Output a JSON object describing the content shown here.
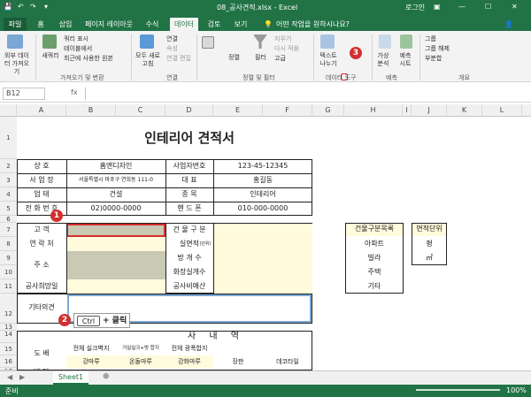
{
  "title_bar": {
    "filename": "08_공사견적.xlsx - Excel",
    "user": "로그인"
  },
  "tabs": [
    "파일",
    "홈",
    "삽입",
    "페이지 레이아웃",
    "수식",
    "데이터",
    "검토",
    "보기"
  ],
  "active_tab": "데이터",
  "tell_me": "어떤 작업을 원하시나요?",
  "ribbon": {
    "ext_data": "외부 데이터 가져오기",
    "new_query": "새쿼리",
    "show_query": "쿼리 표시",
    "from_table": "테이블에서",
    "recent": "최근에 사용한 원본",
    "refresh_all": "모두 새로 고침",
    "connections": "연결",
    "properties": "속성",
    "edit_links": "연결 편집",
    "sort": "정렬",
    "filter": "필터",
    "clear": "지우기",
    "reapply": "다시 적용",
    "advanced": "고급",
    "text_to_col": "텍스트 나누기",
    "whatif": "가상 분석",
    "forecast": "예측 시트",
    "group": "그룹",
    "ungroup": "그룹 해제",
    "subtotal": "부분합",
    "grp_get": "가져오기 및 변환",
    "grp_conn": "연결",
    "grp_sort": "정렬 및 필터",
    "grp_tools": "데이터 도구",
    "grp_forecast": "예측",
    "grp_outline": "개요"
  },
  "namebox": "B12",
  "fx": "fx",
  "columns": [
    "A",
    "B",
    "C",
    "D",
    "E",
    "F",
    "G",
    "H",
    "I",
    "J",
    "K",
    "L"
  ],
  "rows": [
    "1",
    "2",
    "3",
    "4",
    "5",
    "6",
    "7",
    "8",
    "9",
    "10",
    "11",
    "12",
    "13",
    "14",
    "15",
    "16",
    "17"
  ],
  "sheet": {
    "title": "인테리어 견적서",
    "r2": [
      "상 호",
      "홈앤디자인",
      "사업자번호",
      "123-45-12345"
    ],
    "r3": [
      "사 업 장",
      "서울특별시 마포구 연희동 111-0",
      "대 표",
      "홍길동"
    ],
    "r4": [
      "업 태",
      "건설",
      "종 목",
      "인테리어"
    ],
    "r5": [
      "전 화 번 호",
      "02)0000-0000",
      "핸 드 폰",
      "010-000-0000"
    ],
    "r7": [
      "고 객",
      "건 물 구 분"
    ],
    "r8": [
      "연 락 처",
      "실면적",
      "(단위)"
    ],
    "r9": [
      "주 소",
      "방 개 수"
    ],
    "r10": [
      "화장실개수"
    ],
    "r11": [
      "공사희망일",
      "공사비예산"
    ],
    "r12": [
      "기타의견"
    ],
    "r14": "사 내 역",
    "r15": [
      "도 배",
      "전체 실크벽지",
      "거실실크+방 합지",
      "전체 광폭합지"
    ],
    "r17": [
      "바 닥",
      "강마루",
      "온돌마루",
      "강화마루",
      "장판",
      "데코타일"
    ],
    "building_hdr": "건물구분목록",
    "building": [
      "아파트",
      "빌라",
      "주택",
      "기타"
    ],
    "area_hdr": "면적단위",
    "area": [
      "평",
      "㎡"
    ]
  },
  "callouts": {
    "b1": "1",
    "b2": "2",
    "b3": "3",
    "key": "Ctrl",
    "plus": "+ 클릭"
  },
  "sheet_tab": "Sheet1",
  "status": {
    "ready": "준비",
    "zoom": "100%"
  }
}
